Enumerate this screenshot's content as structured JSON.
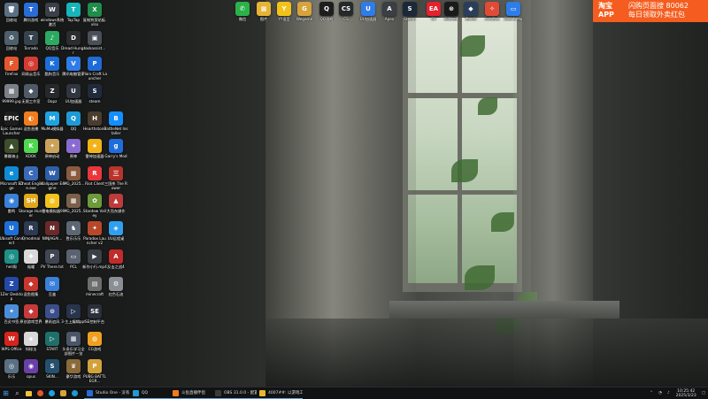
{
  "desktop": {
    "icons": [
      {
        "label": "回收站",
        "glyph": "🗑",
        "color": "#5b6f83"
      },
      {
        "label": "腾讯游戏",
        "glyph": "T",
        "color": "#2a6bd6"
      },
      {
        "label": "windows系统激活",
        "glyph": "W",
        "color": "#3a3f48"
      },
      {
        "label": "TapTap",
        "glyph": "T",
        "color": "#17b4b9"
      },
      {
        "label": "复制到剪贴板.xlsx",
        "glyph": "X",
        "color": "#1f8d4b"
      },
      {
        "label": "回收站",
        "glyph": "♻",
        "color": "#4d5e6d"
      },
      {
        "label": "Torrado",
        "glyph": "T",
        "color": "#36434f"
      },
      {
        "label": "QQ音乐",
        "glyph": "♪",
        "color": "#2caa62"
      },
      {
        "label": "Dread Hunger",
        "glyph": "D",
        "color": "#2b2d2f"
      },
      {
        "label": "taskassist...",
        "glyph": "▣",
        "color": "#4a4f57"
      },
      {
        "label": "FireFox",
        "glyph": "F",
        "color": "#e4572e"
      },
      {
        "label": "网易云音乐",
        "glyph": "◎",
        "color": "#d43c33"
      },
      {
        "label": "酷狗音乐",
        "glyph": "K",
        "color": "#1c6fd8"
      },
      {
        "label": "腾讯电脑管家",
        "glyph": "V",
        "color": "#2f7ce8"
      },
      {
        "label": "Plain Craft Launcher",
        "glyph": "P",
        "color": "#1e6bd6"
      },
      {
        "label": "99999.jpg",
        "glyph": "▦",
        "color": "#7b7f86"
      },
      {
        "label": "无限工作室",
        "glyph": "◆",
        "color": "#505a66"
      },
      {
        "label": "Oopz",
        "glyph": "Z",
        "color": "#26282b"
      },
      {
        "label": "UU加速器",
        "glyph": "U",
        "color": "#303640"
      },
      {
        "label": "steam",
        "glyph": "S",
        "color": "#1f2b3d"
      },
      {
        "label": "Epic Games Launcher",
        "glyph": "EPIC",
        "color": "#1e1e1e"
      },
      {
        "label": "逗鱼直播",
        "glyph": "◐",
        "color": "#f07c1e"
      },
      {
        "label": "MuMu模拟器",
        "glyph": "M",
        "color": "#1fa3e0"
      },
      {
        "label": "QQ",
        "glyph": "Q",
        "color": "#1e9ad6"
      },
      {
        "label": "Hearthstone",
        "glyph": "H",
        "color": "#4a3d2e"
      },
      {
        "label": "BattleNet Installer",
        "glyph": "B",
        "color": "#148eff"
      },
      {
        "label": "暴躁骑士",
        "glyph": "▲",
        "color": "#3d4e2b"
      },
      {
        "label": "KOOK",
        "glyph": "K",
        "color": "#4ed84f"
      },
      {
        "label": "原神启动",
        "glyph": "✦",
        "color": "#caa25a"
      },
      {
        "label": "原神",
        "glyph": "✦",
        "color": "#8a6bd0"
      },
      {
        "label": "雷神加速器",
        "glyph": "★",
        "color": "#f2b21a"
      },
      {
        "label": "Garry's Mod",
        "glyph": "g",
        "color": "#1f6ddb"
      },
      {
        "label": "Microsoft Edge",
        "glyph": "e",
        "color": "#0f8bd6"
      },
      {
        "label": "Cheat Engine.exe",
        "glyph": "C",
        "color": "#3a6ab8"
      },
      {
        "label": "Wallpaper Engine",
        "glyph": "W",
        "color": "#2d5fa8"
      },
      {
        "label": "IMG_2025...",
        "glyph": "▦",
        "color": "#8a5a3f"
      },
      {
        "label": "Riot Client",
        "glyph": "R",
        "color": "#e8373c"
      },
      {
        "label": "三国杀 The Rower",
        "glyph": "三",
        "color": "#b8342b"
      },
      {
        "label": "雷鸣",
        "glyph": "◉",
        "color": "#3a7fd8"
      },
      {
        "label": "Storage Hunter",
        "glyph": "SH",
        "color": "#e0a81a"
      },
      {
        "label": "雷电模拟器9",
        "glyph": "◍",
        "color": "#f1c11d"
      },
      {
        "label": "IMG_2025...",
        "glyph": "▦",
        "color": "#7a5f4a"
      },
      {
        "label": "Stardew Valley",
        "glyph": "✿",
        "color": "#6d9a3b"
      },
      {
        "label": "大而东操作",
        "glyph": "▲",
        "color": "#bd3b3b"
      },
      {
        "label": "Ubisoft Connect",
        "glyph": "U",
        "color": "#1d6fd8"
      },
      {
        "label": "Qmodmai",
        "glyph": "R",
        "color": "#2c3a52"
      },
      {
        "label": "NINJAGAI...",
        "glyph": "N",
        "color": "#6a2a2a"
      },
      {
        "label": "胜乐乐乐",
        "glyph": "♞",
        "color": "#5c6774"
      },
      {
        "label": "Paradox Launcher v2",
        "glyph": "✦",
        "color": "#b8482a"
      },
      {
        "label": "UU远程桌",
        "glyph": "◈",
        "color": "#2fa0f0"
      },
      {
        "label": "hell周",
        "glyph": "◎",
        "color": "#1d8f88"
      },
      {
        "label": "福曜",
        "glyph": "✚",
        "color": "#d8d8d8"
      },
      {
        "label": "PV There.txt",
        "glyph": "P",
        "color": "#404652"
      },
      {
        "label": "PCL",
        "glyph": "▭",
        "color": "#5a6270"
      },
      {
        "label": "新作小行.mp4",
        "glyph": "▶",
        "color": "#3a3f48"
      },
      {
        "label": "反击之战4",
        "glyph": "A",
        "color": "#c02b2b"
      },
      {
        "label": "1Zer Desktop",
        "glyph": "Z",
        "color": "#2349a8"
      },
      {
        "label": "逗鱼图集",
        "glyph": "◆",
        "color": "#c8372e"
      },
      {
        "label": "豆盒",
        "glyph": "✉",
        "color": "#3a7fd8"
      },
      {
        "label": "minecraft",
        "glyph": "▤",
        "color": "#6d6d6d"
      },
      {
        "label": "红色石油",
        "glyph": "⚙",
        "color": "#8a8f96"
      },
      {
        "label": "百灵书签",
        "glyph": "✦",
        "color": "#4c8dd8"
      },
      {
        "label": "原创游戏世界",
        "glyph": "◆",
        "color": "#c63a3a"
      },
      {
        "label": "暴雨追风",
        "glyph": "⊙",
        "color": "#3a4f8a"
      },
      {
        "label": "3·主上编辑ppt",
        "glyph": "▷",
        "color": "#27344a"
      },
      {
        "label": "SE控制平台",
        "glyph": "SE",
        "color": "#2a2f3a"
      },
      {
        "label": "WPS Office",
        "glyph": "W",
        "color": "#d4241c"
      },
      {
        "label": "知秘法",
        "glyph": "◈",
        "color": "#d8d8d8"
      },
      {
        "label": "START",
        "glyph": "▷",
        "color": "#1f6f6a"
      },
      {
        "label": "头条乐学习全部图片一览",
        "glyph": "▦",
        "color": "#4a5568"
      },
      {
        "label": "CG游戏",
        "glyph": "◍",
        "color": "#f0a020"
      },
      {
        "label": "乐乐",
        "glyph": "◎",
        "color": "#5b6f83"
      },
      {
        "label": "opus",
        "glyph": "◉",
        "color": "#6a3fa8"
      },
      {
        "label": "SKIN...",
        "glyph": "S",
        "color": "#25516e"
      },
      {
        "label": "豪华游戏",
        "glyph": "♛",
        "color": "#8a6a3a"
      },
      {
        "label": "PUBG BATTLEGR...",
        "glyph": "P",
        "color": "#d2a23a"
      },
      {
        "label": "微信",
        "glyph": "✆",
        "color": "#2bb24a"
      },
      {
        "label": "图片",
        "glyph": "▦",
        "color": "#e7b336"
      },
      {
        "label": "YY语音",
        "glyph": "Y",
        "color": "#f2c21a"
      },
      {
        "label": "Wegame",
        "glyph": "G",
        "color": "#d7a33a"
      },
      {
        "label": "QQ游戏",
        "glyph": "Q",
        "color": "#1e1e1e"
      },
      {
        "label": "CS",
        "glyph": "CS",
        "color": "#27282a"
      },
      {
        "label": "UU加速器",
        "glyph": "U",
        "color": "#2f7de8"
      },
      {
        "label": "Apex",
        "glyph": "A",
        "color": "#3b3e44"
      },
      {
        "label": "Steam",
        "glyph": "S",
        "color": "#1b2838"
      },
      {
        "label": "EA",
        "glyph": "EA",
        "color": "#e4212d"
      },
      {
        "label": "迅游加速",
        "glyph": "⊛",
        "color": "#1a1a1a"
      },
      {
        "label": "雷神游",
        "glyph": "◆",
        "color": "#2a3e5c"
      },
      {
        "label": "吉吉游戏",
        "glyph": "✧",
        "color": "#e14b36"
      },
      {
        "label": "网易MuMu",
        "glyph": "▭",
        "color": "#2f7de8"
      }
    ]
  },
  "ad": {
    "brand": "淘宝APP",
    "line1": "闪购页面搜 80062",
    "line2": "每日领取外卖红包"
  },
  "taskbar": {
    "start_glyph": "⊞",
    "search_glyph": "⌕",
    "apps": [
      {
        "label": "Studio One - 没有…",
        "color": "#2a6bd6"
      },
      {
        "label": "QQ",
        "color": "#1e9ad6"
      },
      {
        "label": "斗鱼直播伴侣",
        "color": "#f07c1e"
      },
      {
        "label": "OBS 31.0.0 - 配置…",
        "color": "#3b3b3b"
      },
      {
        "label": "4007##: 以游戏工…",
        "color": "#e8b730"
      }
    ],
    "tray": {
      "time": "10:25:42",
      "date": "2025/3/23"
    }
  },
  "colors": {
    "taskbar_bg": "#111213",
    "ad_bg": "#f45d1f"
  }
}
